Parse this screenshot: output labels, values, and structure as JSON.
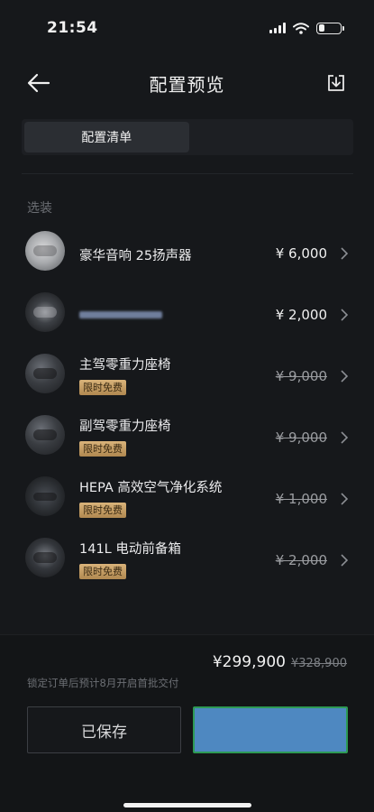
{
  "status": {
    "time": "21:54"
  },
  "header": {
    "title": "配置预览"
  },
  "tabs": [
    {
      "label": "配置清单"
    },
    {
      "label": ""
    }
  ],
  "section": {
    "label": "选装"
  },
  "items": [
    {
      "name": "豪华音响 25扬声器",
      "price": "¥ 6,000",
      "badge": "",
      "strike": false
    },
    {
      "name": "",
      "price": "¥ 2,000",
      "badge": "",
      "strike": false
    },
    {
      "name": "主驾零重力座椅",
      "price": "¥ 9,000",
      "badge": "限时免费",
      "strike": true
    },
    {
      "name": "副驾零重力座椅",
      "price": "¥ 9,000",
      "badge": "限时免费",
      "strike": true
    },
    {
      "name": "HEPA 高效空气净化系统",
      "price": "¥ 1,000",
      "badge": "限时免费",
      "strike": true
    },
    {
      "name": "141L 电动前备箱",
      "price": "¥ 2,000",
      "badge": "限时免费",
      "strike": true
    }
  ],
  "footer": {
    "total_price": "¥299,900",
    "original_price": "¥328,900",
    "delivery_note": "锁定订单后预计8月开启首批交付",
    "saved_label": "已保存",
    "primary_label": ""
  }
}
